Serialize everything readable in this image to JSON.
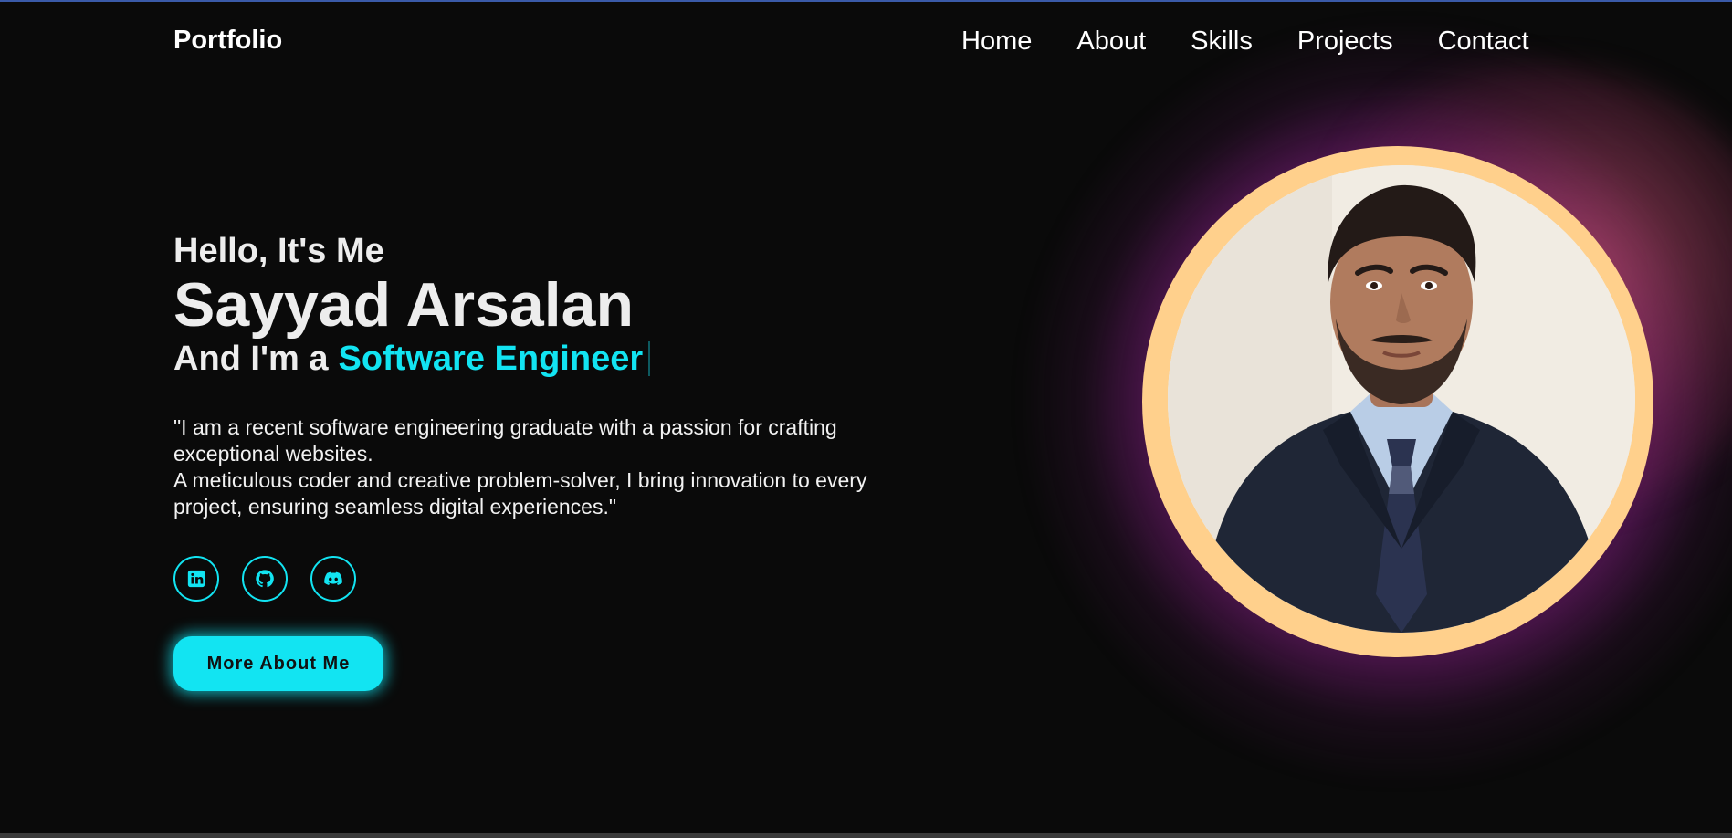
{
  "nav": {
    "logo": "Portfolio",
    "links": [
      "Home",
      "About",
      "Skills",
      "Projects",
      "Contact"
    ]
  },
  "hero": {
    "greeting": "Hello, It's Me",
    "name": "Sayyad Arsalan",
    "role_prefix": "And I'm a",
    "role_typed": "Software Engineer",
    "quote_line1": "\"I am a recent software engineering graduate with a passion for crafting exceptional websites.",
    "quote_line2": "A meticulous coder and creative problem-solver, I bring innovation to every project, ensuring seamless digital experiences.\"",
    "cta_label": "More About Me"
  },
  "socials": [
    {
      "icon": "linkedin-icon"
    },
    {
      "icon": "github-icon"
    },
    {
      "icon": "discord-icon"
    }
  ],
  "colors": {
    "accent": "#12e4f2",
    "background": "#0a0a0a",
    "ring": "#ffd08c",
    "glow": "#b428be"
  }
}
